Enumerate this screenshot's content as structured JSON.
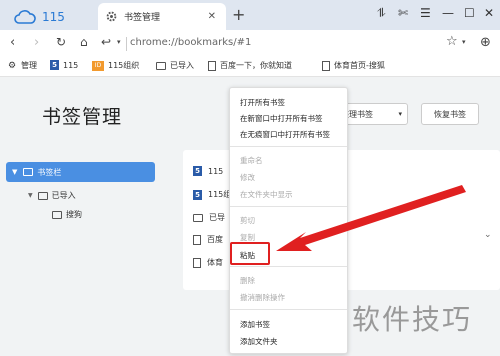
{
  "tabs": [
    {
      "label": "115",
      "icon": "cloud-icon"
    },
    {
      "label": "书签管理",
      "icon": "gear-icon"
    }
  ],
  "window_controls": [
    "⥮",
    "✄",
    "☰",
    "—",
    "☐",
    "✕"
  ],
  "nav": {
    "url": "chrome://bookmarks/#1"
  },
  "bookmarks_bar": [
    {
      "label": "管理",
      "icon": "gear-icon"
    },
    {
      "label": "115",
      "icon": "site-5-icon"
    },
    {
      "label": "115组织",
      "icon": "org-icon"
    },
    {
      "label": "已导入",
      "icon": "folder-icon"
    },
    {
      "label": "百度一下，你就知道",
      "icon": "page-icon"
    },
    {
      "label": "体育首页-搜狐",
      "icon": "page-icon"
    }
  ],
  "sidebar": {
    "title": "书签管理",
    "items": [
      {
        "label": "书签栏",
        "selected": true
      },
      {
        "label": "已导入"
      },
      {
        "label": "搜狗"
      }
    ]
  },
  "toolbar": {
    "organize_label": "整理书签",
    "restore_label": "恢复书签"
  },
  "list": [
    {
      "label": "115",
      "icon": "site-5-icon"
    },
    {
      "label": "115组",
      "icon": "site-5-icon"
    },
    {
      "label": "已导",
      "icon": "folder-icon"
    },
    {
      "label": "百度",
      "icon": "page-icon"
    },
    {
      "label": "体育",
      "icon": "page-icon"
    }
  ],
  "context_menu": {
    "group1": [
      "打开所有书签",
      "在新窗口中打开所有书签",
      "在无痕窗口中打开所有书签"
    ],
    "group2": [
      "重命名",
      "修改",
      "在文件夹中显示"
    ],
    "group3": [
      "剪切",
      "复制",
      "粘贴"
    ],
    "group4": [
      "删除",
      "撤消删除操作"
    ],
    "group5": [
      "添加书签",
      "添加文件夹"
    ]
  },
  "watermark": "软件技巧",
  "colors": {
    "accent": "#4a8fe2",
    "highlight": "#e02020"
  }
}
